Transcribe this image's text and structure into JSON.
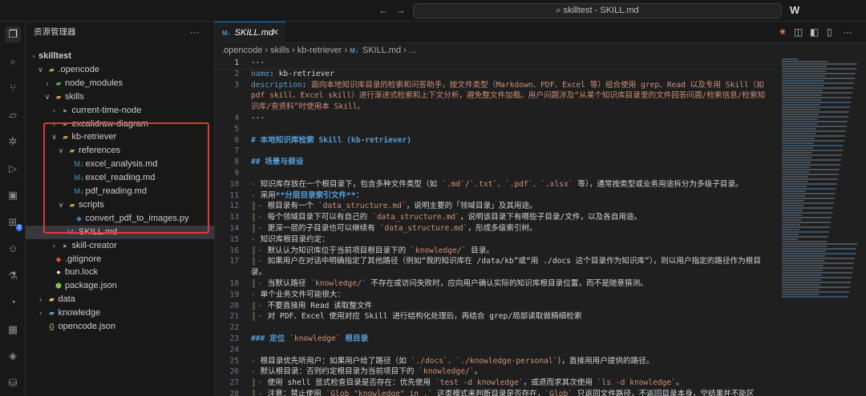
{
  "titlebar": {
    "search_text": "skilltest - SKILL.md",
    "back": "←",
    "forward": "→",
    "logo": "W"
  },
  "activity": [
    {
      "name": "explorer-icon",
      "g": "❐",
      "on": true
    },
    {
      "name": "search-icon",
      "g": "⌕"
    },
    {
      "name": "source-control-icon",
      "g": "⑂"
    },
    {
      "name": "map-icon",
      "g": "▱"
    },
    {
      "name": "debug-icon",
      "g": "✲"
    },
    {
      "name": "run-icon",
      "g": "▷"
    },
    {
      "name": "remote-icon",
      "g": "▣"
    },
    {
      "name": "extensions-icon",
      "g": "⊞",
      "badge": "2"
    },
    {
      "name": "account-icon",
      "g": "☺"
    },
    {
      "name": "testing-icon",
      "g": "⚗"
    },
    {
      "name": "timeline-icon",
      "g": "◔"
    },
    {
      "name": "grid-icon",
      "g": "▦"
    },
    {
      "name": "git-icon",
      "g": "◈"
    },
    {
      "name": "database-icon",
      "g": "⛁"
    }
  ],
  "sidebar": {
    "title": "资源管理器",
    "more": "···",
    "tree": [
      {
        "label": "skilltest",
        "d": 0,
        "t": "root"
      },
      {
        "label": ".opencode",
        "d": 1,
        "t": "fo"
      },
      {
        "label": "node_modules",
        "d": 2,
        "t": "fg"
      },
      {
        "label": "skills",
        "d": 2,
        "t": "fo"
      },
      {
        "label": "current-time-node",
        "d": 3,
        "t": "f"
      },
      {
        "label": "excalidraw-diagram",
        "d": 3,
        "t": "f"
      },
      {
        "label": "kb-retriever",
        "d": 3,
        "t": "fo"
      },
      {
        "label": "references",
        "d": 4,
        "t": "fo"
      },
      {
        "label": "excel_analysis.md",
        "d": 5,
        "t": "md"
      },
      {
        "label": "excel_reading.md",
        "d": 5,
        "t": "md"
      },
      {
        "label": "pdf_reading.md",
        "d": 5,
        "t": "md"
      },
      {
        "label": "scripts",
        "d": 4,
        "t": "fo"
      },
      {
        "label": "convert_pdf_to_images.py",
        "d": 5,
        "t": "py"
      },
      {
        "label": "SKILL.md",
        "d": 4,
        "t": "md",
        "sel": true
      },
      {
        "label": "skill-creator",
        "d": 3,
        "t": "f"
      },
      {
        "label": ".gitignore",
        "d": 2,
        "t": "git"
      },
      {
        "label": "bun.lock",
        "d": 2,
        "t": "bun"
      },
      {
        "label": "package.json",
        "d": 2,
        "t": "pkg"
      },
      {
        "label": "data",
        "d": 1,
        "t": "fy"
      },
      {
        "label": "knowledge",
        "d": 1,
        "t": "fb"
      },
      {
        "label": "opencode.json",
        "d": 1,
        "t": "json"
      }
    ]
  },
  "tab": {
    "label": "SKILL.md",
    "close": "✕",
    "md_icon": "M↓"
  },
  "breadcrumb": [
    ".opencode",
    "skills",
    "kb-retriever",
    "SKILL.md",
    "..."
  ],
  "highlight_color": "#e0383b",
  "editor": {
    "lines": [
      {
        "n": "1",
        "s": [
          [
            "p",
            "---"
          ]
        ]
      },
      {
        "n": "2",
        "s": [
          [
            "k",
            "name"
          ],
          [
            "p",
            ": kb-retriever"
          ]
        ]
      },
      {
        "n": "3",
        "s": [
          [
            "k",
            "description"
          ],
          [
            "p",
            ": "
          ],
          [
            "s",
            "面向本地知识库目录的检索和问答助手，按文件类型（Markdown、PDF、Excel 等）组合使用 grep、Read 以及专用 Skill（如 pdf skill、Excel skill）进行渐进式检索和上下文分析，避免整文件加载。用户问题涉及“从某个知识库目录里的文件回答问题/检索信息/检索知识库/查资料”时使用本 Skill。"
          ]
        ]
      },
      {
        "n": "4",
        "s": [
          [
            "p",
            "---"
          ]
        ]
      },
      {
        "n": "5",
        "s": []
      },
      {
        "n": "6",
        "s": [
          [
            "h",
            "# 本地知识库检索 Skill (kb-retriever)"
          ]
        ]
      },
      {
        "n": "7",
        "s": []
      },
      {
        "n": "8",
        "s": [
          [
            "h",
            "## 场景与假设"
          ]
        ]
      },
      {
        "n": "9",
        "s": []
      },
      {
        "n": "10",
        "s": [
          [
            "b",
            "- "
          ],
          [
            "p",
            "知识库存放在一个根目录下，包含多种文件类型（如 "
          ],
          [
            "c",
            "`.md`/`.txt`、`.pdf`、`.xlsx`"
          ],
          [
            "p",
            " 等），通常按类型或业务用途拆分为多级子目录。"
          ]
        ]
      },
      {
        "n": "11",
        "s": [
          [
            "b",
            "- "
          ],
          [
            "p",
            "采用"
          ],
          [
            "bo",
            "**分层目录索引文件**"
          ],
          [
            "p",
            "："
          ]
        ]
      },
      {
        "n": "12",
        "g": 1,
        "s": [
          [
            "b",
            "- "
          ],
          [
            "p",
            "根目录有一个 "
          ],
          [
            "c",
            "`data_structure.md`"
          ],
          [
            "p",
            "，说明主要的「领域目录」及其用途。"
          ]
        ]
      },
      {
        "n": "13",
        "g": 1,
        "s": [
          [
            "b",
            "- "
          ],
          [
            "p",
            "每个领域目录下可以有自己的 "
          ],
          [
            "c",
            "`data_structure.md`"
          ],
          [
            "p",
            "，说明该目录下有哪些子目录/文件，以及各自用途。"
          ]
        ]
      },
      {
        "n": "14",
        "g": 1,
        "s": [
          [
            "b",
            "- "
          ],
          [
            "p",
            "更深一层的子目录也可以继续有 "
          ],
          [
            "c",
            "`data_structure.md`"
          ],
          [
            "p",
            "，形成多级索引树。"
          ]
        ]
      },
      {
        "n": "15",
        "s": [
          [
            "b",
            "- "
          ],
          [
            "p",
            "知识库根目录约定："
          ]
        ]
      },
      {
        "n": "16",
        "g": 1,
        "s": [
          [
            "b",
            "- "
          ],
          [
            "p",
            "默认认为知识库位于当前项目根目录下的 "
          ],
          [
            "c",
            "`knowledge/`"
          ],
          [
            "p",
            " 目录。"
          ]
        ]
      },
      {
        "n": "17",
        "g": 1,
        "s": [
          [
            "b",
            "- "
          ],
          [
            "p",
            "如果用户在对话中明确指定了其他路径（例如“我的知识库在 /data/kb”或“用 ./docs 这个目录作为知识库”），则以用户指定的路径作为根目录。"
          ]
        ]
      },
      {
        "n": "18",
        "g": 1,
        "s": [
          [
            "b",
            "- "
          ],
          [
            "p",
            "当默认路径 "
          ],
          [
            "c",
            "`knowledge/`"
          ],
          [
            "p",
            " 不存在或访问失败时，应向用户确认实际的知识库根目录位置，而不是随意猜测。"
          ]
        ]
      },
      {
        "n": "19",
        "s": [
          [
            "b",
            "- "
          ],
          [
            "p",
            "单个业务文件可能很大："
          ]
        ]
      },
      {
        "n": "20",
        "g": 1,
        "s": [
          [
            "b",
            "- "
          ],
          [
            "p",
            "不要直接用 Read 读取整文件"
          ]
        ]
      },
      {
        "n": "21",
        "g": 1,
        "s": [
          [
            "b",
            "- "
          ],
          [
            "p",
            "对 PDF、Excel 使用对应 Skill 进行结构化处理后，再结合 grep/局部读取做精细检索"
          ]
        ]
      },
      {
        "n": "22",
        "s": []
      },
      {
        "n": "23",
        "s": [
          [
            "h",
            "### 定位 "
          ],
          [
            "c",
            "`knowledge`"
          ],
          [
            "h",
            " 根目录"
          ]
        ]
      },
      {
        "n": "24",
        "s": []
      },
      {
        "n": "25",
        "s": [
          [
            "b",
            "- "
          ],
          [
            "p",
            "根目录优先听用户：如果用户给了路径（如 "
          ],
          [
            "c",
            "`./docs`、`./knowledge-personal`"
          ],
          [
            "p",
            "），直接用用户提供的路径。"
          ]
        ]
      },
      {
        "n": "26",
        "s": [
          [
            "b",
            "- "
          ],
          [
            "p",
            "默认根目录：否则约定根目录为当前项目下的 "
          ],
          [
            "c",
            "`knowledge/`"
          ],
          [
            "p",
            "。"
          ]
        ]
      },
      {
        "n": "27",
        "g": 1,
        "s": [
          [
            "b",
            "- "
          ],
          [
            "p",
            "使用 shell 显式检查目录是否存在：优先使用 "
          ],
          [
            "c",
            "`test -d knowledge`"
          ],
          [
            "p",
            "，或退而求其次使用 "
          ],
          [
            "c",
            "`ls -d knowledge`"
          ],
          [
            "p",
            "。"
          ]
        ]
      },
      {
        "n": "28",
        "g": 1,
        "s": [
          [
            "b",
            "- "
          ],
          [
            "p",
            "注意：禁止使用 "
          ],
          [
            "c",
            "`Glob \"knowledge\" in .`"
          ],
          [
            "p",
            " 这类模式来判断目录是否存在，"
          ],
          [
            "c",
            "`Glob`"
          ],
          [
            "p",
            " 只返回文件路径，不返回目录本身，空结果并不能区分“目录不存在”和“目录存在但为空”。"
          ]
        ]
      }
    ]
  }
}
